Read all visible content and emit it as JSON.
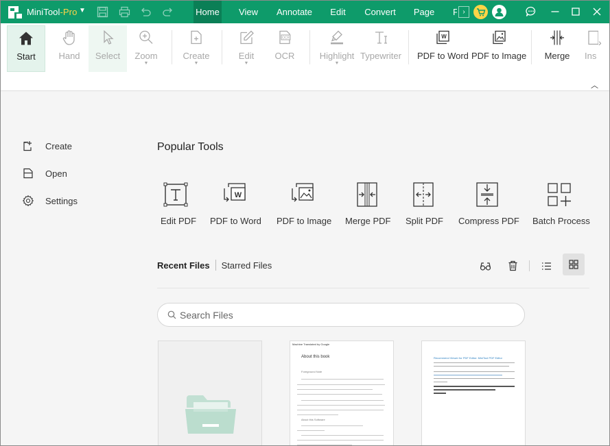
{
  "app": {
    "name": "MiniTool",
    "edition": "-Pro"
  },
  "menu": [
    {
      "id": "home",
      "label": "Home",
      "active": true
    },
    {
      "id": "view",
      "label": "View"
    },
    {
      "id": "annotate",
      "label": "Annotate"
    },
    {
      "id": "edit",
      "label": "Edit"
    },
    {
      "id": "convert",
      "label": "Convert"
    },
    {
      "id": "page",
      "label": "Page"
    },
    {
      "id": "more",
      "label": "F"
    }
  ],
  "ribbon": {
    "start": "Start",
    "hand": "Hand",
    "select": "Select",
    "zoom": "Zoom",
    "create": "Create",
    "edit": "Edit",
    "ocr": "OCR",
    "highlight": "Highlight",
    "typewriter": "Typewriter",
    "pdf_to_word": "PDF to Word",
    "pdf_to_image": "PDF to Image",
    "merge": "Merge",
    "insert": "Ins"
  },
  "sidebar": {
    "create": "Create",
    "open": "Open",
    "settings": "Settings"
  },
  "popular_tools": {
    "title": "Popular Tools",
    "items": {
      "edit_pdf": "Edit PDF",
      "pdf_to_word": "PDF to Word",
      "pdf_to_image": "PDF to Image",
      "merge_pdf": "Merge PDF",
      "split_pdf": "Split PDF",
      "compress_pdf": "Compress PDF",
      "batch_process": "Batch Process"
    }
  },
  "files": {
    "tab_recent": "Recent Files",
    "tab_starred": "Starred Files",
    "search_placeholder": "Search Files"
  },
  "doc2": {
    "header": "Machine Translated by Google",
    "title": "About this book",
    "section": "Foreground Note",
    "section2": "About this Software"
  },
  "doc3": {
    "title": "Recommend Viewer for PDF Editor: MiniTool PDF Editor"
  },
  "colors": {
    "brand": "#0e9b6a",
    "accent_pro": "#ffd447",
    "folder": "#c2e0d3"
  }
}
